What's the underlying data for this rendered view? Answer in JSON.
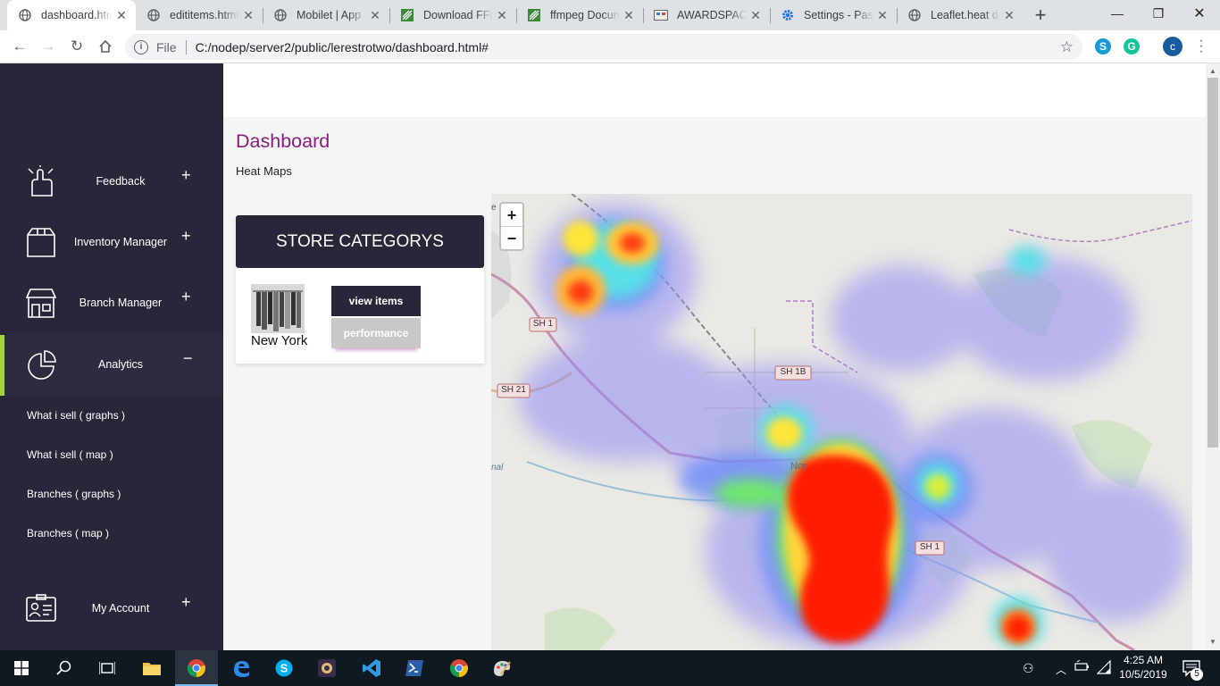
{
  "browser": {
    "tabs": [
      {
        "title": "dashboard.html",
        "favicon": "globe-icon",
        "active": true
      },
      {
        "title": "edititems.html",
        "favicon": "globe-icon"
      },
      {
        "title": "Mobilet | App",
        "favicon": "globe-icon"
      },
      {
        "title": "Download FFm",
        "favicon": "ffmpeg-icon"
      },
      {
        "title": "ffmpeg Docum",
        "favicon": "ffmpeg-icon"
      },
      {
        "title": "AWARDSPACE",
        "favicon": "awardspace-icon"
      },
      {
        "title": "Settings - Pass",
        "favicon": "gear-icon"
      },
      {
        "title": "Leaflet.heat de",
        "favicon": "globe-icon"
      }
    ],
    "new_tab": "+",
    "address": {
      "scheme": "File",
      "url": "C:/nodep/server2/public/lerestrotwo/dashboard.html#"
    },
    "profile_initial": "c"
  },
  "sidebar": {
    "items": [
      {
        "label": "Feedback",
        "icon": "feedback-icon",
        "toggle": "+"
      },
      {
        "label": "Inventory Manager",
        "icon": "box-icon",
        "toggle": "+"
      },
      {
        "label": "Branch Manager",
        "icon": "store-icon",
        "toggle": "+"
      },
      {
        "label": "Analytics",
        "icon": "analytics-icon",
        "toggle": "−",
        "active": true
      },
      {
        "label": "My Account",
        "icon": "account-icon",
        "toggle": "+"
      }
    ],
    "analytics_sub": [
      "What i sell ( graphs )",
      "What i sell ( map )",
      "Branches ( graphs )",
      "Branches ( map )"
    ],
    "accent_color": "#a8d33f"
  },
  "main": {
    "title": "Dashboard",
    "subtitle": "Heat Maps",
    "store_card": {
      "header": "STORE CATEGORYS",
      "store_name": "New York",
      "view_button": "view items",
      "performance_button": "performance"
    },
    "map": {
      "zoom_in": "+",
      "zoom_out": "−",
      "road_labels": [
        "SH 1",
        "SH 21",
        "SH 1B",
        "SH 1"
      ],
      "place_label": "Nor",
      "place_label_left": "nal",
      "edge_label": "e"
    }
  },
  "taskbar": {
    "clock_time": "4:25 AM",
    "clock_date": "10/5/2019",
    "notification_count": "5"
  }
}
